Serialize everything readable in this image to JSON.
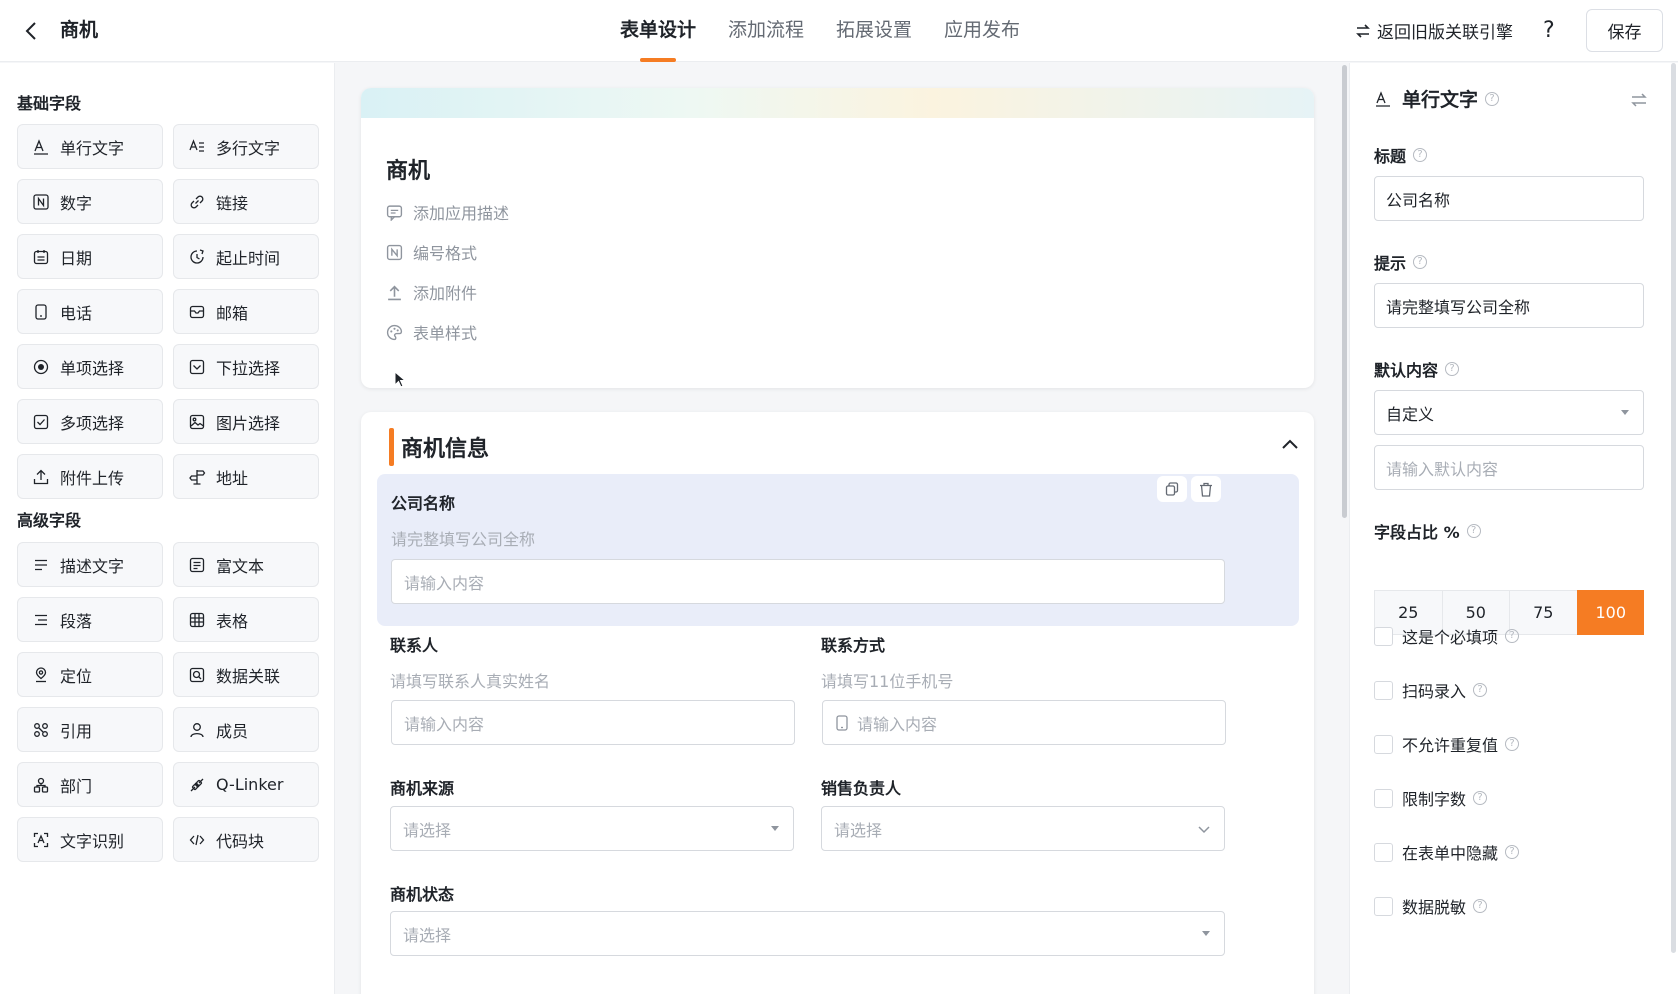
{
  "header": {
    "app_title": "商机",
    "tabs": [
      "表单设计",
      "添加流程",
      "拓展设置",
      "应用发布"
    ],
    "active_tab": "表单设计",
    "legacy_link": "返回旧版关联引擎",
    "help": "?",
    "save": "保存"
  },
  "left": {
    "basic_title": "基础字段",
    "basic_fields": [
      {
        "label": "单行文字",
        "icon": "single-line-text-icon"
      },
      {
        "label": "多行文字",
        "icon": "multi-line-text-icon"
      },
      {
        "label": "数字",
        "icon": "number-icon"
      },
      {
        "label": "链接",
        "icon": "link-icon"
      },
      {
        "label": "日期",
        "icon": "calendar-icon"
      },
      {
        "label": "起止时间",
        "icon": "time-range-icon"
      },
      {
        "label": "电话",
        "icon": "phone-icon"
      },
      {
        "label": "邮箱",
        "icon": "mail-icon"
      },
      {
        "label": "单项选择",
        "icon": "radio-icon"
      },
      {
        "label": "下拉选择",
        "icon": "dropdown-icon"
      },
      {
        "label": "多项选择",
        "icon": "checkbox-icon"
      },
      {
        "label": "图片选择",
        "icon": "image-icon"
      },
      {
        "label": "附件上传",
        "icon": "upload-icon"
      },
      {
        "label": "地址",
        "icon": "address-icon"
      }
    ],
    "advanced_title": "高级字段",
    "advanced_fields": [
      {
        "label": "描述文字",
        "icon": "description-icon"
      },
      {
        "label": "富文本",
        "icon": "rich-text-icon"
      },
      {
        "label": "段落",
        "icon": "paragraph-icon"
      },
      {
        "label": "表格",
        "icon": "table-icon"
      },
      {
        "label": "定位",
        "icon": "location-icon"
      },
      {
        "label": "数据关联",
        "icon": "data-link-icon"
      },
      {
        "label": "引用",
        "icon": "reference-icon"
      },
      {
        "label": "成员",
        "icon": "member-icon"
      },
      {
        "label": "部门",
        "icon": "department-icon"
      },
      {
        "label": "Q-Linker",
        "icon": "q-linker-icon"
      },
      {
        "label": "文字识别",
        "icon": "ocr-icon"
      },
      {
        "label": "代码块",
        "icon": "code-icon"
      }
    ]
  },
  "form": {
    "title": "商机",
    "options": [
      "添加应用描述",
      "编号格式",
      "添加附件",
      "表单样式"
    ],
    "section_title": "商机信息",
    "fields": {
      "company": {
        "label": "公司名称",
        "hint": "请完整填写公司全称",
        "placeholder": "请输入内容"
      },
      "contact": {
        "label": "联系人",
        "hint": "请填写联系人真实姓名",
        "placeholder": "请输入内容"
      },
      "phone": {
        "label": "联系方式",
        "hint": "请填写11位手机号",
        "placeholder": "请输入内容"
      },
      "source": {
        "label": "商机来源",
        "placeholder": "请选择"
      },
      "sales": {
        "label": "销售负责人",
        "placeholder": "请选择"
      },
      "status": {
        "label": "商机状态",
        "placeholder": "请选择"
      }
    }
  },
  "props": {
    "field_type": "单行文字",
    "title_label": "标题",
    "title_value": "公司名称",
    "hint_label": "提示",
    "hint_value": "请完整填写公司全称",
    "default_label": "默认内容",
    "default_mode": "自定义",
    "default_placeholder": "请输入默认内容",
    "width_label": "字段占比 %",
    "width_options": [
      "25",
      "50",
      "75",
      "100"
    ],
    "width_selected": "100",
    "checkboxes": [
      "这是个必填项",
      "扫码录入",
      "不允许重复值",
      "限制字数",
      "在表单中隐藏",
      "数据脱敏"
    ]
  },
  "colors": {
    "accent": "#f57c23",
    "selected_field_bg": "#e9edf9"
  }
}
